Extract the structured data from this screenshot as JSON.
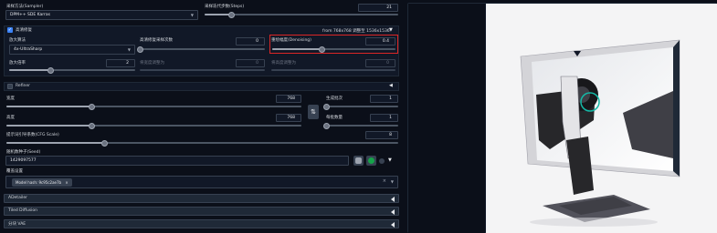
{
  "sampler": {
    "label": "采样方法(Sampler)",
    "value": "DPM++ SDE Karras"
  },
  "steps": {
    "label": "采样迭代步数(Steps)",
    "value": "21",
    "fraction": 0.14
  },
  "hires": {
    "label": "高清修复",
    "info": "from 768x768 调整至 1536x1536",
    "upscaler": {
      "label": "放大算法",
      "value": "4x-UltraSharp"
    },
    "hires_steps": {
      "label": "高清修复采样次数",
      "value": "0",
      "fraction": 0.0
    },
    "denoising": {
      "label": "重绘幅度(Denoising)",
      "value": "0.4",
      "fraction": 0.4
    },
    "upscale_by": {
      "label": "放大倍率",
      "value": "2",
      "fraction": 0.33
    },
    "resize_w": {
      "label": "将宽度调整为",
      "value": "0"
    },
    "resize_h": {
      "label": "将高度调整为",
      "value": "0"
    }
  },
  "refiner": {
    "label": "Refiner"
  },
  "width": {
    "label": "宽度",
    "value": "768",
    "fraction": 0.29
  },
  "height": {
    "label": "高度",
    "value": "768",
    "fraction": 0.29
  },
  "swap_icon": "swap-vertical-icon",
  "batch_count": {
    "label": "生成批次",
    "value": "1",
    "fraction": 0.0
  },
  "batch_size": {
    "label": "每批数量",
    "value": "1",
    "fraction": 0.0
  },
  "cfg": {
    "label": "提示词引导系数(CFG Scale)",
    "value": "8",
    "fraction": 0.25
  },
  "seed": {
    "label": "随机数种子(Seed)",
    "value": "1429097577"
  },
  "override": {
    "label": "覆盖设置",
    "chip": "Model hash: 9c95c2ae7b"
  },
  "accordions": [
    {
      "label": "ADetailer"
    },
    {
      "label": "Tiled Diffusion"
    },
    {
      "label": "分块 VAE"
    }
  ],
  "colors": {
    "accent": "#dc2626",
    "background": "#0b0f19",
    "panel": "#1f2937",
    "dice": "#9ca3af",
    "recycle": "#16a34a"
  }
}
